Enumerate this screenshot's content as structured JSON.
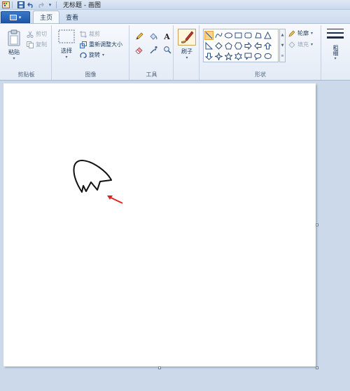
{
  "title": "无标题 - 画图",
  "tabs": {
    "home": "主页",
    "view": "查看"
  },
  "clipboard": {
    "paste": "粘贴",
    "cut": "剪切",
    "copy": "复制",
    "group_label": "剪贴板"
  },
  "image": {
    "select": "选择",
    "crop": "裁剪",
    "resize": "重新调整大小",
    "rotate": "旋转",
    "group_label": "图像"
  },
  "tools": {
    "text_label": "A",
    "group_label": "工具"
  },
  "brushes": {
    "label": "刷子"
  },
  "shapes": {
    "outline": "轮廓",
    "fill": "填充",
    "group_label": "形状"
  },
  "size": {
    "label": "粗细"
  },
  "icons": [
    "save-icon",
    "undo-icon",
    "redo-icon",
    "paste-icon",
    "scissors-icon",
    "copy-icon",
    "select-icon",
    "crop-icon",
    "resize-icon",
    "rotate-icon",
    "pencil-icon",
    "fill-bucket-icon",
    "text-icon",
    "eraser-icon",
    "color-picker-icon",
    "magnifier-icon",
    "brush-icon",
    "outline-icon",
    "fill-icon",
    "line-weight-icon"
  ],
  "colors": {
    "accent": "#1f57a8",
    "arrow": "#e02020",
    "selected_shape": "#fbd28a"
  }
}
